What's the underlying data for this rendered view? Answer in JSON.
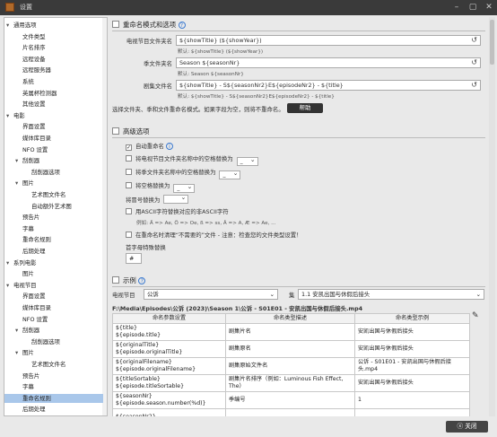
{
  "window": {
    "title": "设置"
  },
  "sidebar": {
    "items": [
      {
        "label": "通用选项",
        "level": 0,
        "toggle": "▾"
      },
      {
        "label": "文件类型",
        "level": 1
      },
      {
        "label": "片名排序",
        "level": 1
      },
      {
        "label": "远程设备",
        "level": 1
      },
      {
        "label": "远程服务器",
        "level": 1
      },
      {
        "label": "系统",
        "level": 1
      },
      {
        "label": "英属杯检测器",
        "level": 1
      },
      {
        "label": "其他设置",
        "level": 1
      },
      {
        "label": "电影",
        "level": 0,
        "toggle": "▾"
      },
      {
        "label": "界面设置",
        "level": 1
      },
      {
        "label": "媒体库目录",
        "level": 1
      },
      {
        "label": "NFO 设置",
        "level": 1
      },
      {
        "label": "刮削器",
        "level": 1,
        "toggle": "▾"
      },
      {
        "label": "刮削器选项",
        "level": 2
      },
      {
        "label": "图片",
        "level": 1,
        "toggle": "▾"
      },
      {
        "label": "艺术图文件名",
        "level": 2
      },
      {
        "label": "自动额外艺术图",
        "level": 2
      },
      {
        "label": "预告片",
        "level": 1
      },
      {
        "label": "字幕",
        "level": 1
      },
      {
        "label": "重命名规则",
        "level": 1
      },
      {
        "label": "后期处理",
        "level": 1
      },
      {
        "label": "系列电影",
        "level": 0,
        "toggle": "▾"
      },
      {
        "label": "图片",
        "level": 1
      },
      {
        "label": "电视节目",
        "level": 0,
        "toggle": "▾"
      },
      {
        "label": "界面设置",
        "level": 1
      },
      {
        "label": "媒体库目录",
        "level": 1
      },
      {
        "label": "NFO 设置",
        "level": 1
      },
      {
        "label": "刮削器",
        "level": 1,
        "toggle": "▾"
      },
      {
        "label": "刮削器选项",
        "level": 2
      },
      {
        "label": "图片",
        "level": 1,
        "toggle": "▾"
      },
      {
        "label": "艺术图文件名",
        "level": 2
      },
      {
        "label": "预告片",
        "level": 1
      },
      {
        "label": "字幕",
        "level": 1
      },
      {
        "label": "重命名规则",
        "level": 1,
        "selected": true
      },
      {
        "label": "后期处理",
        "level": 1
      }
    ]
  },
  "renamer": {
    "section_title": "重命名模式和选项",
    "show_folder_label": "电视节目文件夹名",
    "show_folder_value": "${showTitle} (${showYear})",
    "show_folder_default": "默认: ${showTitle} (${showYear})",
    "season_folder_label": "季文件夹名",
    "season_folder_value": "Season ${seasonNr}",
    "season_folder_default": "默认: Season ${seasonNr}",
    "episode_file_label": "剧集文件名",
    "episode_file_value": "${showTitle} - S${seasonNr2}E${episodeNr2} - ${title}",
    "episode_file_default": "默认: ${showTitle} - S${seasonNr2}E${episodeNr2} - ${title}",
    "help_text": "选择文件夹、季和文件重命名模式。如果字段为空，则将不重命名。",
    "help_button": "帮助"
  },
  "advanced": {
    "section_title": "高级选项",
    "auto_rename": "自动重命名",
    "replace_space_show": "将电视节目文件夹名称中的空格替换为",
    "replace_space_season": "将季文件夹名称中的空格替换为",
    "replace_space_file": "将空格替换为",
    "replace_colon": "将冒号替换为",
    "ascii_replace": "用ASCII字符替换对应的非ASCII字符",
    "ascii_example": "例如: Ä => Ae, Ö => Oe, ß => ss, Ā => A, Æ => Ae, ...",
    "cleanup_note": "在重命名时清理“不需要的”文件 - 注意：检查您的文件类型设置！",
    "first_char_label": "首字母特殊替换",
    "first_char_value": "#",
    "space_value": "_"
  },
  "example": {
    "section_title": "示例",
    "show_label": "电视节目",
    "show_value": "公诉",
    "episode_label": "集",
    "episode_value": "1.1 安凯出国与休假后接头",
    "path": "F:\\Media\\Episodes\\公诉 (2023)\\Season 1\\公诉 - S01E01 - 安凯出国与休假后接头.mp4",
    "columns": [
      "命名参数设置",
      "命名类型描述",
      "命名类型示例"
    ],
    "rows": [
      {
        "token": "${title}\n${episode.title}",
        "desc": "剧集片名",
        "example": "安凯出国与休假后接头"
      },
      {
        "token": "${originalTitle}\n${episode.originalTitle}",
        "desc": "剧集原名",
        "example": "安凯出国与休假后接头"
      },
      {
        "token": "${originalFilename}\n${episode.originalFilename}",
        "desc": "剧集原始文件名",
        "example": "公诉 - S01E01 - 安凯出国与休假后接头.mp4"
      },
      {
        "token": "${titleSortable}\n${episode.titleSortable}",
        "desc": "剧集片名排序（例如：Luminous Fish Effect, The）",
        "example": "安凯出国与休假后接头"
      },
      {
        "token": "${seasonNr}\n${episode.season.number(%d)}",
        "desc": "季编号",
        "example": "1"
      },
      {
        "token": "${seasonNr2}",
        "desc": "",
        "example": ""
      }
    ]
  },
  "footer": {
    "close_label": "关闭"
  },
  "colors": {
    "selected": "#a9c7ea",
    "accent": "#3d7bd0",
    "button": "#333333"
  }
}
